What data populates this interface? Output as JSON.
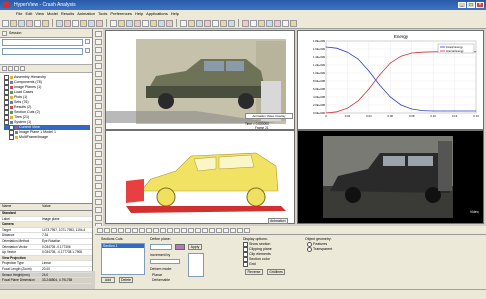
{
  "window": {
    "title": "HyperView - Crash Analysis"
  },
  "menu": [
    "File",
    "Edit",
    "View",
    "Model",
    "Results",
    "Animation",
    "Tools",
    "Preferences",
    "Help",
    "Applications",
    "Help"
  ],
  "left_panel": {
    "header": "Session",
    "tabs": [
      "Results",
      "Vehicle"
    ],
    "tree": [
      "Assembly Hierarchy",
      "Components (78)",
      "Image Planes (1)",
      "Load Cases",
      "Plots (1)",
      "Sets (76)",
      "Results (2)",
      "Section Cuts (2)",
      "Tires (21)",
      "System (1)",
      "Current View",
      "Image Plane 1 Model 1",
      "MultiFrame/Image"
    ],
    "props_header": {
      "col1": "Name",
      "col2": "Value"
    },
    "props": [
      {
        "n": "Standard",
        "v": "",
        "h": true
      },
      {
        "n": "Label",
        "v": "Image plane"
      },
      {
        "n": "Camera",
        "v": "",
        "h": true
      },
      {
        "n": "Target",
        "v": "1473.7957, 1071.7953, 1194.4"
      },
      {
        "n": "Distance",
        "v": "7.34"
      },
      {
        "n": "Orientation Method",
        "v": "Eye Rotation"
      },
      {
        "n": "Orientation Vector",
        "v": "0.034705 -0.177306"
      },
      {
        "n": "Up Vector",
        "v": "0.034705, -0.177738 1.7908"
      },
      {
        "n": "View Projection",
        "v": "",
        "h": true
      },
      {
        "n": "Projection Type",
        "v": "Linear"
      },
      {
        "n": "Focal Length (Zoom)",
        "v": "20.00"
      },
      {
        "n": "Sensor Height(mm)",
        "v": "24.0"
      },
      {
        "n": "Focal Plane Dimension",
        "v": "33.248804, 4.791758"
      }
    ]
  },
  "viewports": {
    "tr_label": "Animation Video Overlay",
    "tr_time": "Time = 0.000000",
    "tr_frame": "Frame 21",
    "bl_label": "Animation",
    "br_tag": "Video",
    "chart_title": "Energy"
  },
  "chart_data": {
    "type": "line",
    "title": "Energy",
    "xlim": [
      0,
      0.14
    ],
    "ylim": [
      0,
      1.8
    ],
    "yticks": [
      "1.8E+009",
      "1.6E+009",
      "1.4E+009",
      "1.2E+009",
      "1.0E+009",
      "8.0E+008",
      "6.0E+008",
      "4.0E+008",
      "2.0E+008",
      "0.0E+000"
    ],
    "xticks": [
      "0",
      "0.02",
      "0.04",
      "0.06",
      "0.08",
      "0.10",
      "0.12",
      "0.14"
    ],
    "series": [
      {
        "name": "Kinetic Energy",
        "color": "#2f3fbf",
        "x": [
          0,
          0.01,
          0.02,
          0.03,
          0.04,
          0.05,
          0.06,
          0.07,
          0.08,
          0.09,
          0.1,
          0.11,
          0.12,
          0.13,
          0.14
        ],
        "y": [
          1.65,
          1.62,
          1.52,
          1.35,
          1.05,
          0.7,
          0.4,
          0.2,
          0.1,
          0.06,
          0.05,
          0.05,
          0.05,
          0.05,
          0.05
        ]
      },
      {
        "name": "Internal Energy",
        "color": "#d03030",
        "x": [
          0,
          0.01,
          0.02,
          0.03,
          0.04,
          0.05,
          0.06,
          0.07,
          0.08,
          0.09,
          0.1,
          0.11,
          0.12,
          0.13,
          0.14
        ],
        "y": [
          0.0,
          0.03,
          0.12,
          0.3,
          0.6,
          0.95,
          1.25,
          1.42,
          1.5,
          1.52,
          1.53,
          1.53,
          1.53,
          1.53,
          1.53
        ]
      }
    ]
  },
  "bottom_panel": {
    "section_cuts_label": "Sections Cuts",
    "section_item": "Section 1",
    "define_plane": "Define plane:",
    "base_label": "Base",
    "apply": "Apply",
    "increment_by": "Increment by",
    "deform_mode": "Deform mode:",
    "planar": "Planar",
    "deformable": "Deformable",
    "display_options": "Display options:",
    "opts": [
      "Show section",
      "Clipping plane",
      "Clip elements",
      "Section color",
      "Grid"
    ],
    "object_geometry": "Object geometry:",
    "geom": [
      "Features",
      "Transparent"
    ],
    "add": "Add",
    "delete": "Delete",
    "reverse": "Reverse",
    "gridlines": "Gridlines"
  }
}
